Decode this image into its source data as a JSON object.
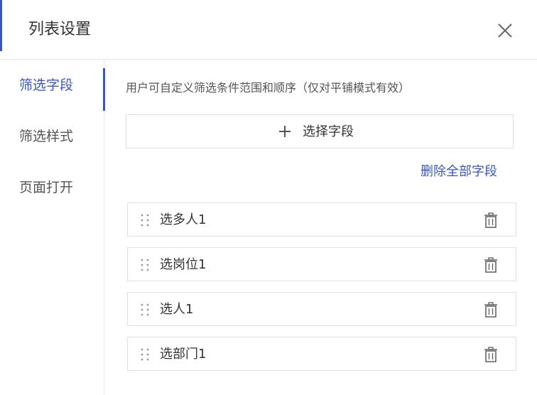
{
  "dialog": {
    "title": "列表设置"
  },
  "sidebar": {
    "items": [
      {
        "label": "筛选字段"
      },
      {
        "label": "筛选样式"
      },
      {
        "label": "页面打开"
      }
    ]
  },
  "content": {
    "description": "用户可自定义筛选条件范围和顺序（仅对平铺模式有效）",
    "select_button_label": "选择字段",
    "delete_all_label": "删除全部字段",
    "fields": [
      {
        "label": "选多人1"
      },
      {
        "label": "选岗位1"
      },
      {
        "label": "选人1"
      },
      {
        "label": "选部门1"
      }
    ]
  },
  "colors": {
    "accent": "#3a56c5",
    "border": "#e0e0e0",
    "text": "#333333"
  }
}
